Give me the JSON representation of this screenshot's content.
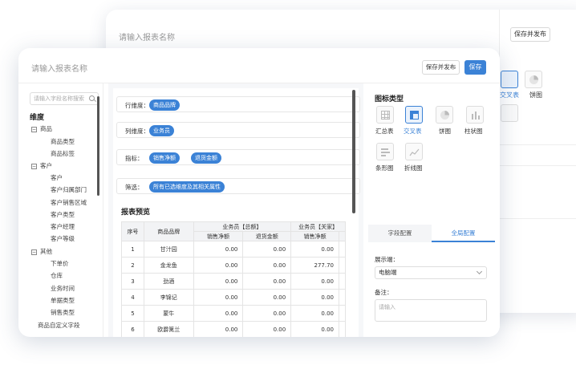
{
  "bg_window": {
    "title": "请输入报表名称",
    "save_publish": "保存并发布",
    "chart_labels": [
      "交叉表",
      "饼图"
    ]
  },
  "header": {
    "report_name_placeholder": "请输入报表名称",
    "save_publish_label": "保存并发布",
    "save_label": "保存"
  },
  "sidebar": {
    "search_placeholder": "请输入字段名称搜索",
    "dimension_title": "维度",
    "groups": [
      {
        "label": "商品",
        "items": [
          "商品类型",
          "商品标签"
        ]
      },
      {
        "label": "客户",
        "items": [
          "客户",
          "客户归属部门",
          "客户销售区域",
          "客户类型",
          "客户经理",
          "客户等级"
        ]
      },
      {
        "label": "其他",
        "items": [
          "下单价",
          "仓库",
          "业务时间",
          "单据类型",
          "销售类型"
        ]
      }
    ],
    "custom_field": "商品自定义字段"
  },
  "center": {
    "rows": [
      {
        "label": "行维度：",
        "tags": [
          "商品品牌"
        ]
      },
      {
        "label": "列维度：",
        "tags": [
          "业务员"
        ]
      },
      {
        "label": "指标：",
        "tags": [
          "销售净额",
          "退货金额"
        ]
      },
      {
        "label": "筛选：",
        "tags": [
          "所有已选维度及其相关属性"
        ]
      }
    ],
    "preview_title": "报表预览",
    "table": {
      "col_no": "序号",
      "col_brand": "商品品牌",
      "group1": "业务员【总额】",
      "group2": "业务员【关家】",
      "sub_net": "销售净额",
      "sub_return": "退货金额",
      "rows": [
        {
          "no": "1",
          "brand": "甘汁园",
          "a": "0.00",
          "b": "0.00",
          "c": "0.00"
        },
        {
          "no": "2",
          "brand": "金龙鱼",
          "a": "0.00",
          "b": "0.00",
          "c": "277.70"
        },
        {
          "no": "3",
          "brand": "劲酒",
          "a": "0.00",
          "b": "0.00",
          "c": "0.00"
        },
        {
          "no": "4",
          "brand": "李锦记",
          "a": "0.00",
          "b": "0.00",
          "c": "0.00"
        },
        {
          "no": "5",
          "brand": "蒙牛",
          "a": "0.00",
          "b": "0.00",
          "c": "0.00"
        },
        {
          "no": "6",
          "brand": "欧爵篱兰",
          "a": "0.00",
          "b": "0.00",
          "c": "0.00"
        }
      ]
    }
  },
  "right": {
    "chart_type_title": "图标类型",
    "chart_types": [
      {
        "label": "汇总表",
        "icon": "table-icon"
      },
      {
        "label": "交叉表",
        "icon": "cross-table-icon"
      },
      {
        "label": "饼图",
        "icon": "pie-chart-icon"
      },
      {
        "label": "柱状图",
        "icon": "bar-chart-icon"
      },
      {
        "label": "条形图",
        "icon": "horizontal-bar-icon"
      },
      {
        "label": "折线图",
        "icon": "line-chart-icon"
      }
    ],
    "tab_field": "字段配置",
    "tab_global": "全局配置",
    "display_label": "展示端：",
    "display_value": "电脑端",
    "note_label": "备注：",
    "note_placeholder": "请输入"
  },
  "colors": {
    "accent": "#3b82d6"
  }
}
